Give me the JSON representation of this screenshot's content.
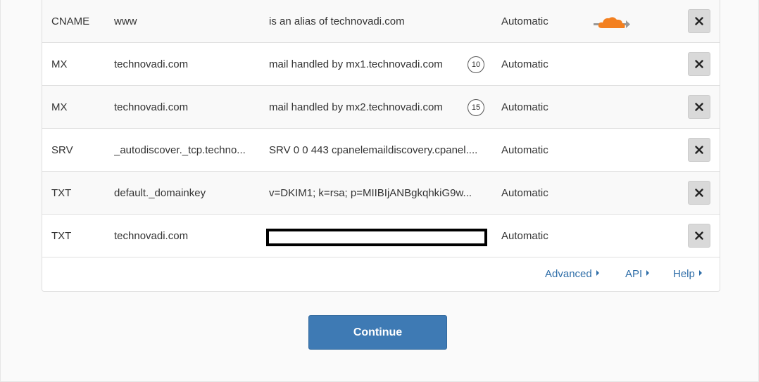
{
  "records": [
    {
      "type": "CNAME",
      "name": "www",
      "content": "is an alias of technovadi.com",
      "ttl": "Automatic",
      "priority": "",
      "proxied": true,
      "redacted": false
    },
    {
      "type": "MX",
      "name": "technovadi.com",
      "content": "mail handled by mx1.technovadi.com",
      "ttl": "Automatic",
      "priority": "10",
      "proxied": false,
      "redacted": false
    },
    {
      "type": "MX",
      "name": "technovadi.com",
      "content": "mail handled by mx2.technovadi.com",
      "ttl": "Automatic",
      "priority": "15",
      "proxied": false,
      "redacted": false
    },
    {
      "type": "SRV",
      "name": "_autodiscover._tcp.techno...",
      "content": "SRV 0 0 443 cpanelemaildiscovery.cpanel....",
      "ttl": "Automatic",
      "priority": "",
      "proxied": false,
      "redacted": false
    },
    {
      "type": "TXT",
      "name": "default._domainkey",
      "content": "v=DKIM1; k=rsa; p=MIIBIjANBgkqhkiG9w...",
      "ttl": "Automatic",
      "priority": "",
      "proxied": false,
      "redacted": false
    },
    {
      "type": "TXT",
      "name": "technovadi.com",
      "content": "",
      "ttl": "Automatic",
      "priority": "",
      "proxied": false,
      "redacted": true
    }
  ],
  "footer": {
    "advanced": "Advanced",
    "api": "API",
    "help": "Help"
  },
  "continue_label": "Continue",
  "icons": {
    "delete": "close-icon",
    "proxy": "cloud-proxy-icon",
    "caret": "caret-right-icon"
  },
  "colors": {
    "link": "#2f6ea8",
    "primary_button": "#3e7ab4",
    "cloud_orange": "#f38020"
  }
}
